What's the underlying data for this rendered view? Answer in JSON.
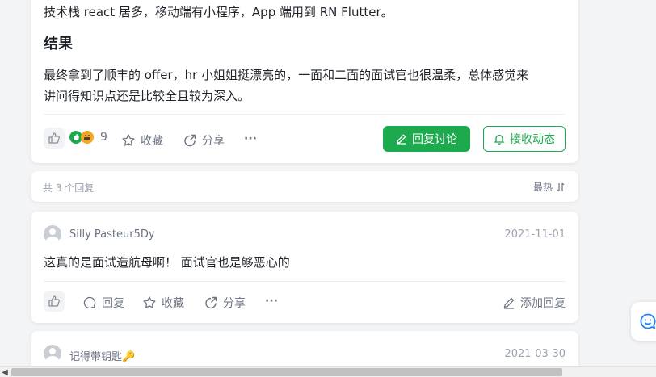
{
  "post": {
    "tech_line": "技术栈 react 居多，移动端有小程序，App 端用到 RN Flutter。",
    "result_heading": "结果",
    "result_para_1": "最终拿到了顺丰的 offer，hr 小姐姐挺漂亮的，一面和二面的面试官也很温柔，总体感觉来",
    "result_para_2": "讲问得知识点还是比较全且较为深入。",
    "actions": {
      "reaction_count": "9",
      "collect_label": "收藏",
      "share_label": "分享",
      "more_label": "···",
      "reply_label": "回复讨论",
      "follow_label": "接收动态"
    }
  },
  "comments_header": {
    "count_label": "共 3 个回复",
    "sort_label": "最热"
  },
  "comments": [
    {
      "username": "Silly Pasteur5Dy",
      "date": "2021-11-01",
      "text": "这真的是面试造航母啊！  面试官也是够恶心的",
      "reply_label": "回复",
      "collect_label": "收藏",
      "share_label": "分享",
      "more_label": "···",
      "add_reply_label": "添加回复"
    },
    {
      "username": "记得带钥匙",
      "username_emoji": "🔑",
      "date": "2021-03-30"
    }
  ],
  "colors": {
    "brand_green": "#1da94e",
    "text_primary": "#1f2329",
    "text_muted": "#6b7280",
    "page_bg": "#f3f4f6"
  },
  "icons": [
    "thumbs-up-icon",
    "star-icon",
    "share-icon",
    "pencil-icon",
    "bell-icon",
    "comment-icon",
    "sort-icon",
    "smile-chat-icon"
  ]
}
